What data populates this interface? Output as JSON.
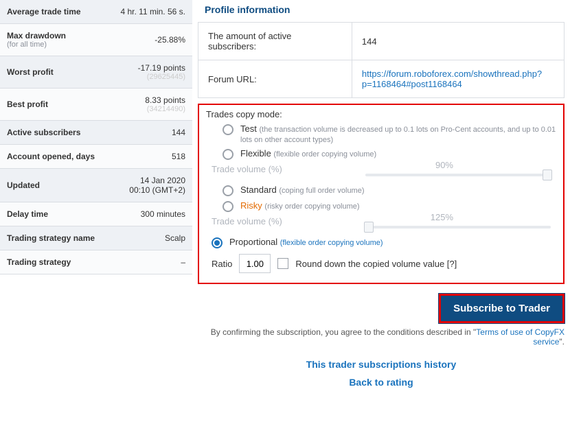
{
  "stats": {
    "avg_trade_time": {
      "label": "Average trade time",
      "value": "4 hr. 11 min. 56 s."
    },
    "max_drawdown": {
      "label": "Max drawdown",
      "sub": "(for all time)",
      "value": "-25.88%"
    },
    "worst_profit": {
      "label": "Worst profit",
      "value": "-17.19 points",
      "id": "(29625445)"
    },
    "best_profit": {
      "label": "Best profit",
      "value": "8.33 points",
      "id": "(34214490)"
    },
    "active_subs": {
      "label": "Active subscribers",
      "value": "144"
    },
    "account_days": {
      "label": "Account opened, days",
      "value": "518"
    },
    "updated": {
      "label": "Updated",
      "value": "14 Jan 2020",
      "value2": "00:10 (GMT+2)"
    },
    "delay_time": {
      "label": "Delay time",
      "value": "300 minutes"
    },
    "strategy_name": {
      "label": "Trading strategy name",
      "value": "Scalp"
    },
    "strategy": {
      "label": "Trading strategy",
      "value": "–"
    }
  },
  "profile": {
    "heading": "Profile information",
    "subs_label": "The amount of active subscribers:",
    "subs_value": "144",
    "forum_label": "Forum URL:",
    "forum_url": "https://forum.roboforex.com/showthread.php?p=1168464#post1168464"
  },
  "copy_mode": {
    "heading": "Trades copy mode:",
    "test": {
      "label": "Test",
      "note": "(the transaction volume is decreased up to 0.1 lots on Pro-Cent accounts, and up to 0.01 lots on other account types)"
    },
    "flexible": {
      "label": "Flexible",
      "note": "(flexible order copying volume)"
    },
    "vol1_heading": "Trade volume (%)",
    "slider1_value": "90%",
    "standard": {
      "label": "Standard",
      "note": "(coping full order volume)"
    },
    "risky": {
      "label": "Risky",
      "note": "(risky order copying volume)"
    },
    "vol2_heading": "Trade volume (%)",
    "slider2_value": "125%",
    "proportional": {
      "label": "Proportional",
      "note": "(flexible order copying volume)"
    },
    "ratio_label": "Ratio",
    "ratio_value": "1.00",
    "round_label": "Round down the copied volume value [?]"
  },
  "actions": {
    "subscribe": "Subscribe to Trader",
    "agree_prefix": "By confirming the subscription, you agree to the conditions described in \"",
    "agree_link": "Terms of use of CopyFX service",
    "agree_suffix": "\".",
    "history_link": "This trader subscriptions history",
    "back_link": "Back to rating"
  }
}
